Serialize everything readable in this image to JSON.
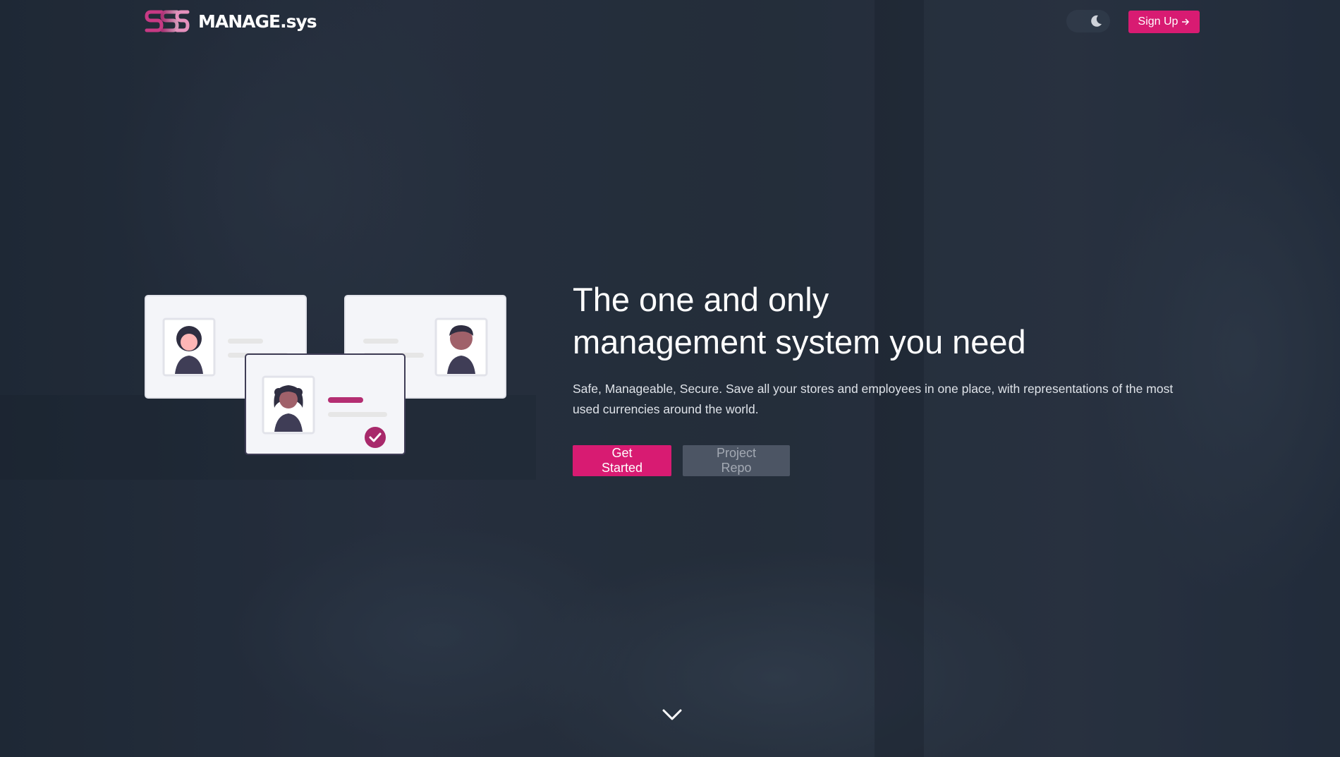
{
  "header": {
    "logo_text": "MANAGE",
    "logo_suffix": ".sys",
    "theme_icon": "moon-icon",
    "signup_label": "Sign Up",
    "signup_icon": "arrow-right-icon"
  },
  "hero": {
    "title_line1": "The one and only",
    "title_line2": "management system you need",
    "description": "Safe, Manageable, Secure. Save all your stores and employees in one place, with representations of the most used currencies around the world.",
    "primary_label": "Get Started",
    "secondary_label": "Project Repo"
  },
  "scroll": {
    "icon": "chevron-down-icon"
  },
  "colors": {
    "accent": "#d81b72",
    "background": "#2a3444",
    "card": "#f4f5f9",
    "avatar_dark": "#3f3d56"
  }
}
